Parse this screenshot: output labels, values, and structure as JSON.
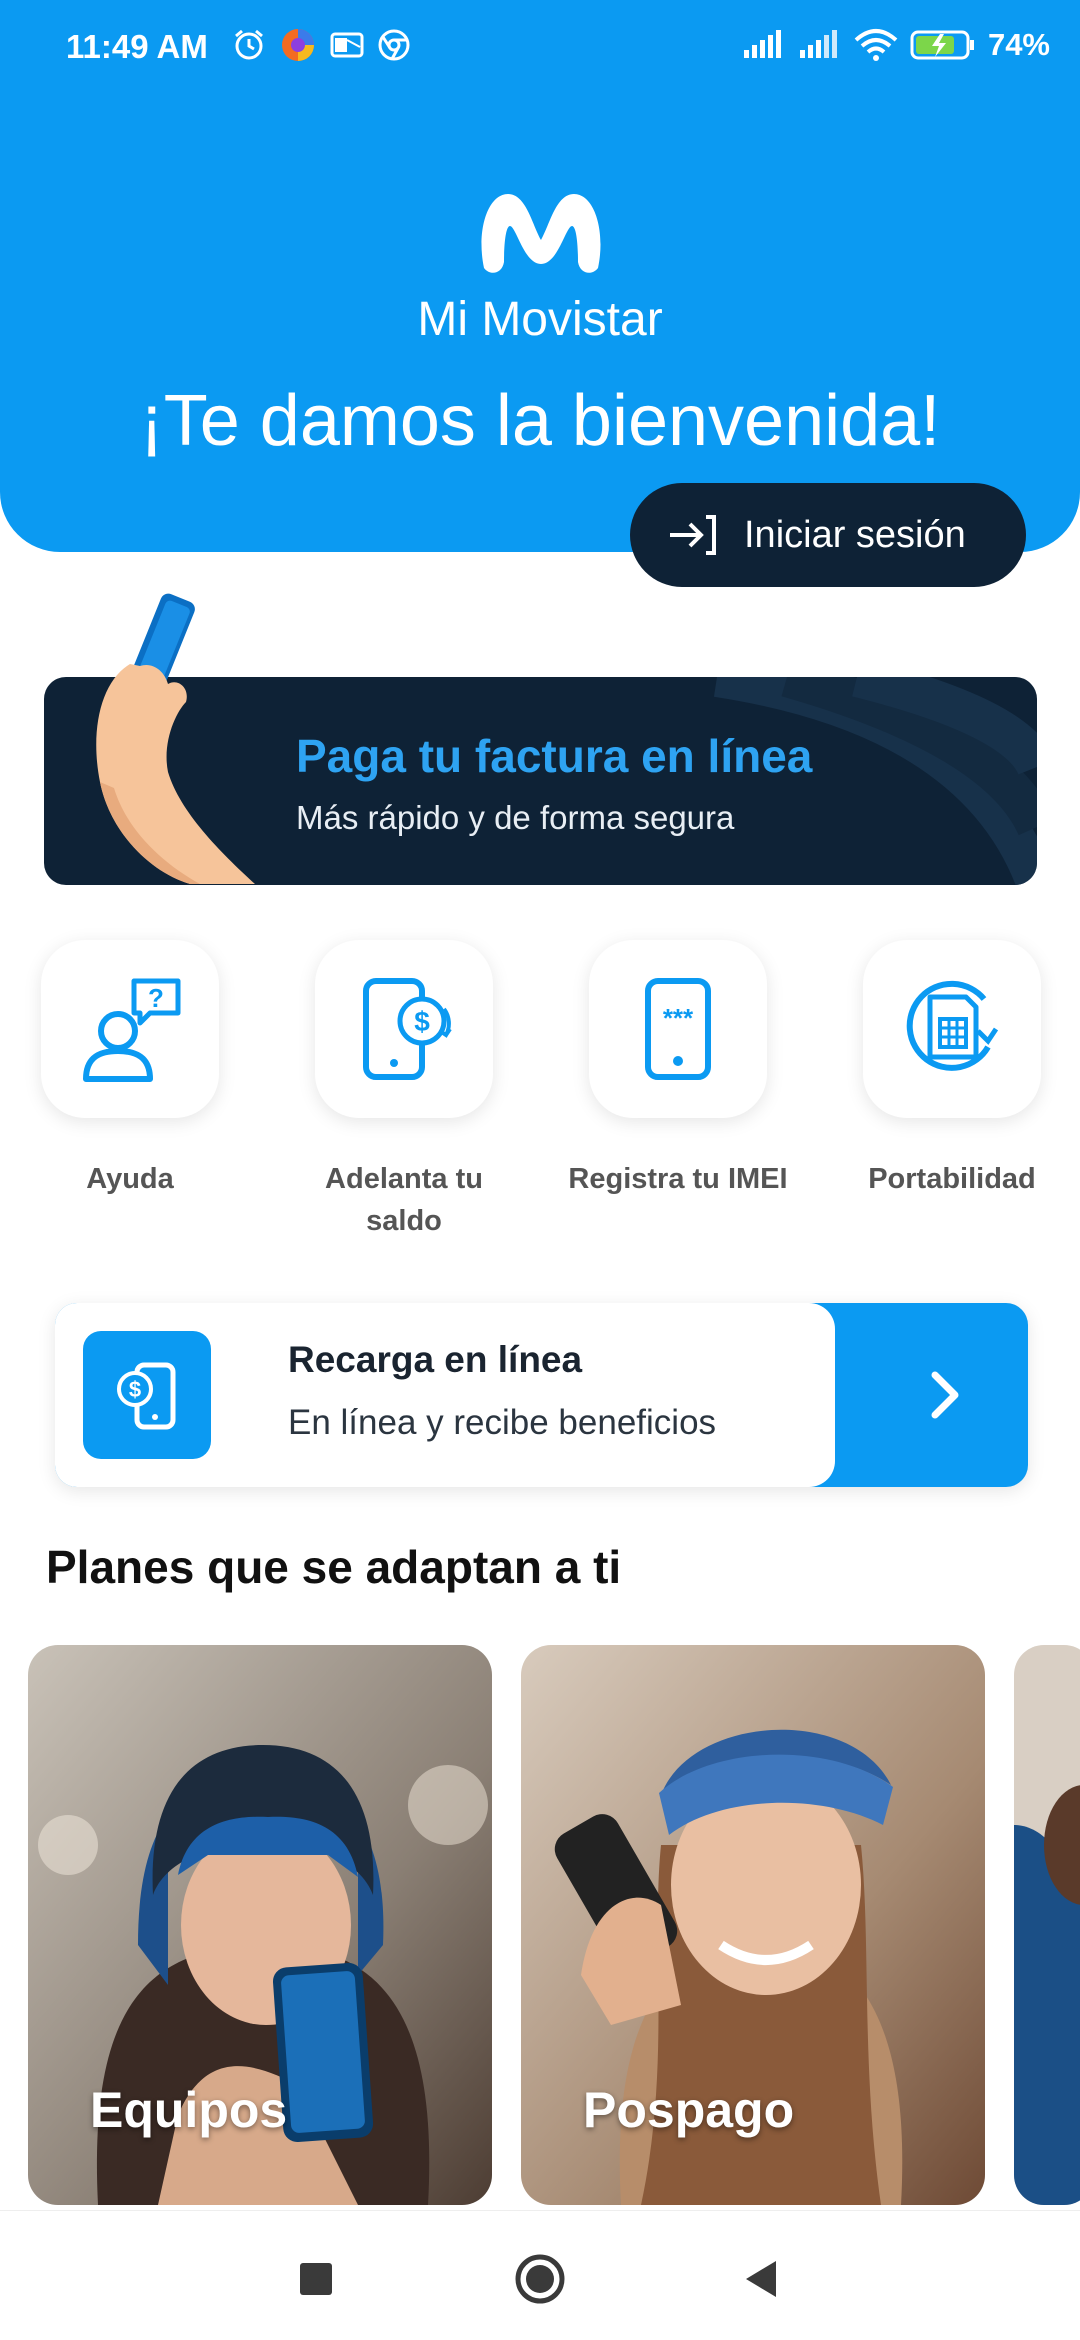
{
  "status_bar": {
    "time": "11:49 AM",
    "battery": "74%"
  },
  "header": {
    "brand": "Mi Movistar",
    "welcome": "¡Te damos la bienvenida!",
    "login_label": "Iniciar sesión"
  },
  "banner": {
    "title": "Paga tu factura en línea",
    "subtitle": "Más rápido y de forma segura"
  },
  "quick_actions": [
    {
      "label": "Ayuda",
      "icon": "help-icon"
    },
    {
      "label": "Adelanta tu saldo",
      "icon": "advance-balance-icon"
    },
    {
      "label": "Registra tu IMEI",
      "icon": "imei-icon"
    },
    {
      "label": "Portabilidad",
      "icon": "portability-icon"
    }
  ],
  "recharge": {
    "title": "Recarga en línea",
    "subtitle": "En línea y recibe beneficios"
  },
  "plans": {
    "title": "Planes que se adaptan a ti",
    "items": [
      {
        "label": "Equipos"
      },
      {
        "label": "Pospago"
      }
    ]
  },
  "colors": {
    "brand_blue": "#0b9af2",
    "navy": "#0e2236",
    "banner_title": "#2ea3f2"
  }
}
